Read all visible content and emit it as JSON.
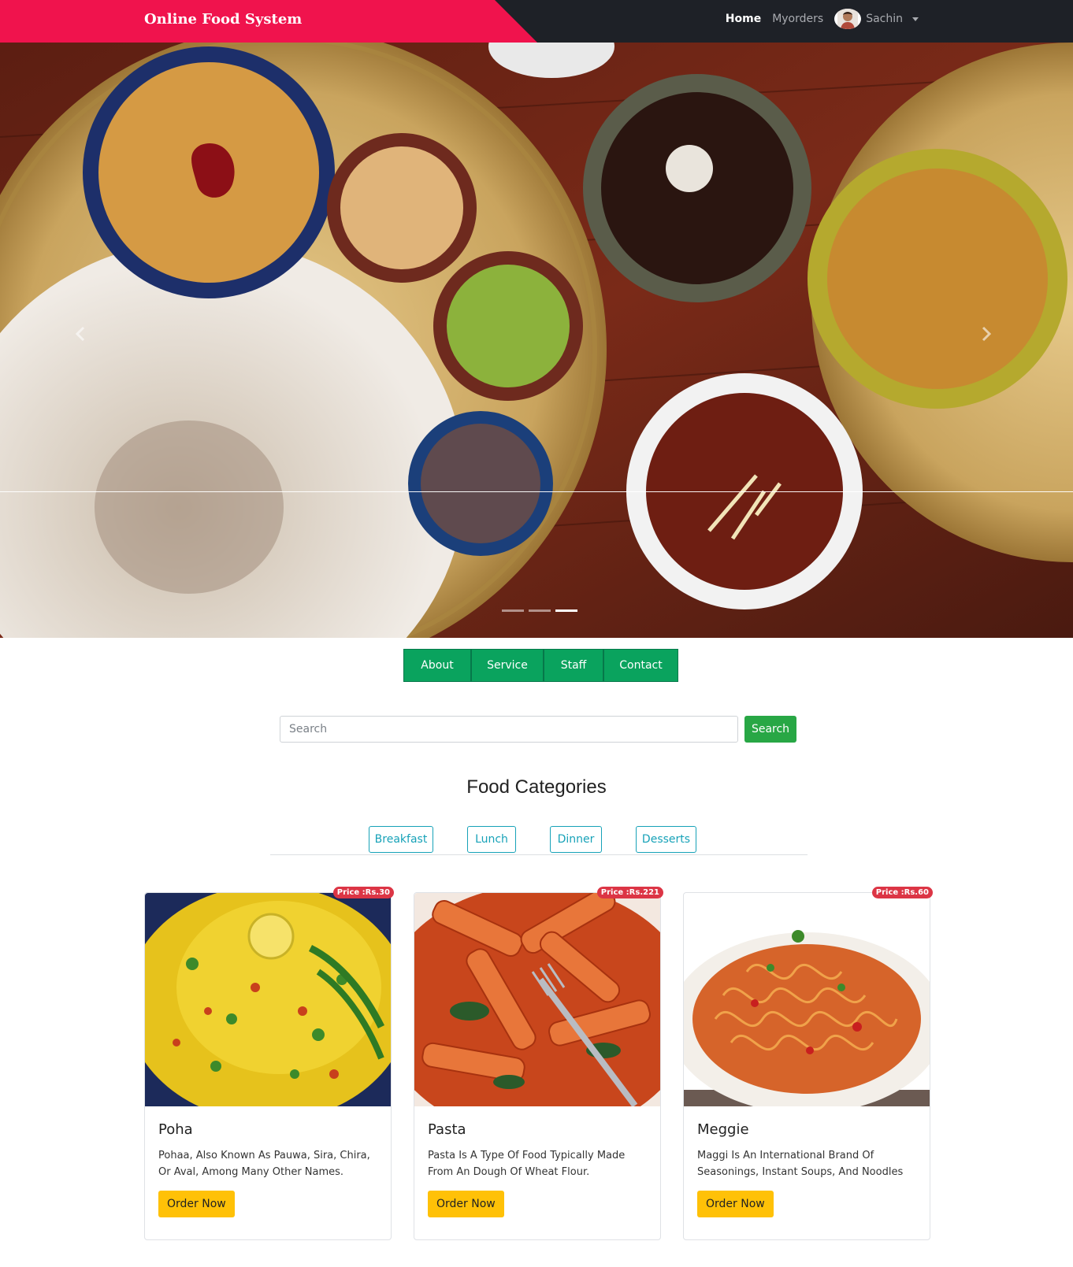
{
  "navbar": {
    "brand": "Online Food System",
    "links": [
      {
        "label": "Home",
        "active": true
      },
      {
        "label": "Myorders",
        "active": false
      }
    ],
    "user_name": "Sachin",
    "avatar_icon": "user-avatar"
  },
  "carousel": {
    "prev_icon": "chevron-left-icon",
    "next_icon": "chevron-right-icon",
    "slide_count": 3,
    "active_slide": 3
  },
  "sections": [
    "About",
    "Service",
    "Staff",
    "Contact"
  ],
  "search": {
    "placeholder": "Search",
    "button": "Search"
  },
  "categories": {
    "title": "Food Categories",
    "items": [
      "Breakfast",
      "Lunch",
      "Dinner",
      "Desserts"
    ]
  },
  "foods": [
    {
      "name": "Poha",
      "price": "Price :Rs.30",
      "description": "Pohaa, Also Known As Pauwa, Sira, Chira, Or Aval, Among Many Other Names.",
      "button": "Order Now"
    },
    {
      "name": "Pasta",
      "price": "Price :Rs.221",
      "description": "Pasta Is A Type Of Food Typically Made From An Dough Of Wheat Flour.",
      "button": "Order Now"
    },
    {
      "name": "Meggie",
      "price": "Price :Rs.60",
      "description": "Maggi Is An International Brand Of Seasonings, Instant Soups, And Noodles",
      "button": "Order Now"
    }
  ],
  "colors": {
    "brand_red": "#f0134d",
    "navbar": "#1e2127",
    "section_green": "#0aa35e",
    "search_green": "#28a745",
    "category_teal": "#17a2b8",
    "order_yellow": "#ffc107",
    "badge_red": "#dc3545"
  }
}
